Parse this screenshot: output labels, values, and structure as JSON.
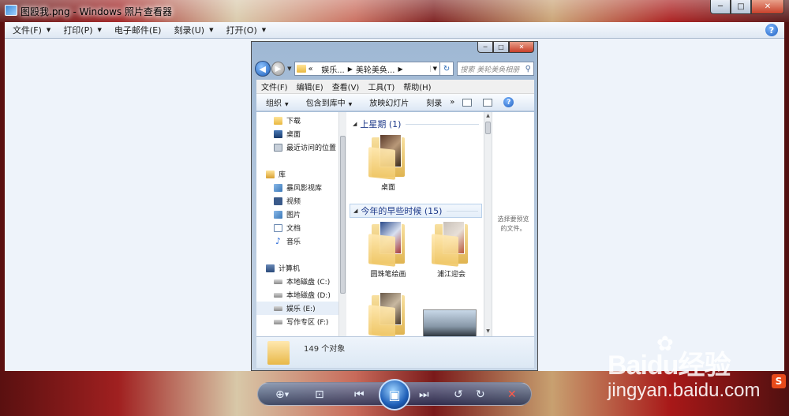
{
  "window": {
    "title": "图殴我.png - Windows 照片查看器",
    "minimize": "─",
    "maximize": "□",
    "close": "✕"
  },
  "menu": {
    "items": [
      {
        "label": "文件(F)"
      },
      {
        "label": "打印(P)"
      },
      {
        "label": "电子邮件(E)"
      },
      {
        "label": "刻录(U)"
      },
      {
        "label": "打开(O)"
      }
    ],
    "help": "?"
  },
  "explorer": {
    "address": {
      "prefix": "«",
      "crumb1": "娱乐...",
      "crumb2": "美轮美奂..."
    },
    "search_placeholder": "搜索 美轮美奂相册",
    "menu": [
      "文件(F)",
      "编辑(E)",
      "查看(V)",
      "工具(T)",
      "帮助(H)"
    ],
    "toolbar": {
      "organize": "组织",
      "include": "包含到库中",
      "slideshow": "放映幻灯片",
      "burn": "刻录",
      "more": "»"
    },
    "nav": {
      "downloads": "下载",
      "desktop": "桌面",
      "recent": "最近访问的位置",
      "libraries": "库",
      "storm": "暴风影视库",
      "videos": "视频",
      "pictures": "图片",
      "documents": "文档",
      "music": "音乐",
      "computer": "计算机",
      "disk_c": "本地磁盘 (C:)",
      "disk_d": "本地磁盘 (D:)",
      "disk_e": "娱乐 (E:)",
      "disk_f": "写作专区 (F:)"
    },
    "groups": {
      "last_week": "上星期 (1)",
      "earlier": "今年的早些时候 (15)"
    },
    "files": {
      "desktop": "桌面",
      "ballpen": "圆珠笔绘画",
      "puzzle": "浦江迎会"
    },
    "preview_hint": "选择要预览的文件。",
    "status": "149 个对象"
  },
  "watermark": {
    "brand": "Baidu经验",
    "url": "jingyan.baidu.com"
  },
  "colors": {
    "accent": "#1e5fb8",
    "group_header": "#1e3a8a",
    "delete": "#ff5a4a"
  }
}
